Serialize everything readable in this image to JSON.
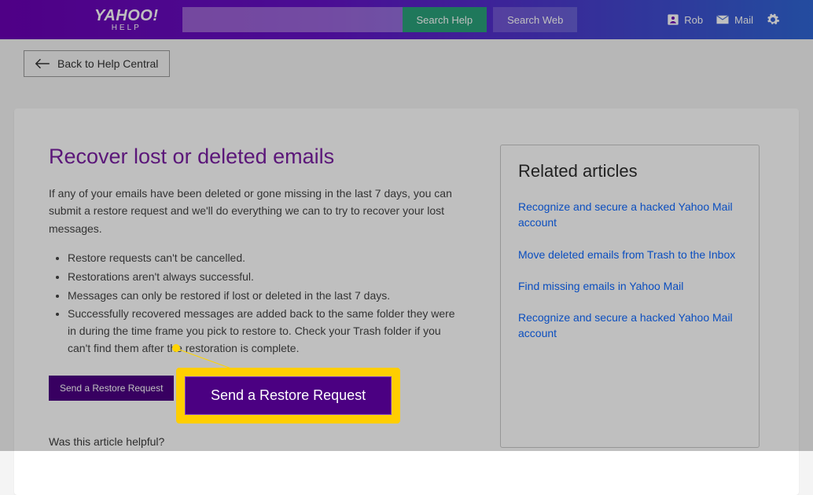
{
  "header": {
    "logo_main": "YAHOO!",
    "logo_sub": "HELP",
    "search_placeholder": "",
    "btn_search_help": "Search Help",
    "btn_search_web": "Search Web",
    "user_name": "Rob",
    "mail_label": "Mail"
  },
  "back_link": "Back to Help Central",
  "article": {
    "title": "Recover lost or deleted emails",
    "intro": "If any of your emails have been deleted or gone missing in the last 7 days, you can submit a restore request and we'll do everything we can to try to recover your lost messages.",
    "bullets": [
      "Restore requests can't be cancelled.",
      "Restorations aren't always successful.",
      "Messages can only be restored if lost or deleted in the last 7 days.",
      "Successfully recovered messages are added back to the same folder they were in during the time frame you pick to restore to. Check your Trash folder if you can't find them after the restoration is complete."
    ],
    "restore_btn": "Send a Restore Request",
    "helpful_question": "Was this article helpful?"
  },
  "related": {
    "heading": "Related articles",
    "links": [
      "Recognize and secure a hacked Yahoo Mail account",
      "Move deleted emails from Trash to the Inbox",
      "Find missing emails in Yahoo Mail",
      "Recognize and secure a hacked Yahoo Mail account"
    ]
  },
  "callout_label": "Send a Restore Request"
}
